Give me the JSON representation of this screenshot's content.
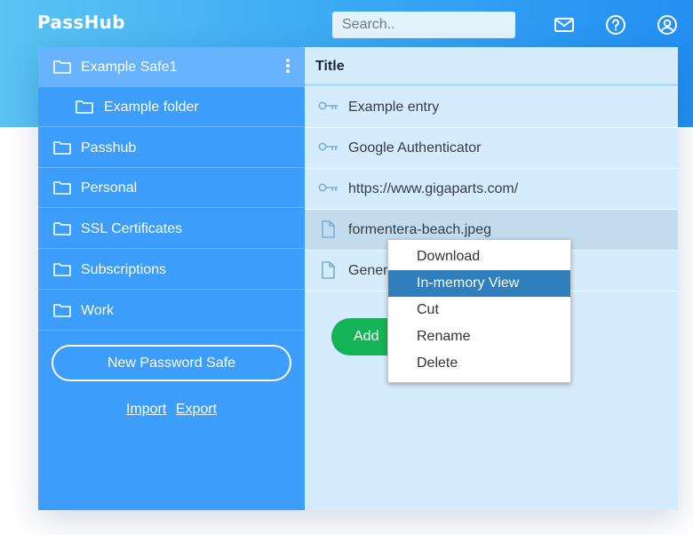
{
  "app": {
    "logo": "PassHub"
  },
  "search": {
    "placeholder": "Search.."
  },
  "header_icons": [
    "mail-icon",
    "help-icon",
    "account-icon"
  ],
  "sidebar": {
    "safes": [
      {
        "label": "Example Safe1",
        "active": true
      },
      {
        "label": "Example folder",
        "sub": true
      },
      {
        "label": "Passhub"
      },
      {
        "label": "Personal"
      },
      {
        "label": "SSL Certificates"
      },
      {
        "label": "Subscriptions"
      },
      {
        "label": "Work"
      }
    ],
    "new_safe_label": "New Password Safe",
    "import_label": "Import",
    "export_label": "Export"
  },
  "main": {
    "column_title": "Title",
    "items": [
      {
        "label": "Example entry",
        "icon": "key-icon"
      },
      {
        "label": "Google Authenticator",
        "icon": "key-icon"
      },
      {
        "label": "https://www.gigaparts.com/",
        "icon": "key-icon"
      },
      {
        "label": "formentera-beach.jpeg",
        "icon": "file-icon",
        "selected": true
      },
      {
        "label": "Generl",
        "icon": "file-icon"
      }
    ],
    "add_label": "Add"
  },
  "context_menu": {
    "items": [
      "Download",
      "In-memory View",
      "Cut",
      "Rename",
      "Delete"
    ],
    "highlighted": "In-memory View"
  },
  "colors": {
    "header_gradient": [
      "#5bc3f3",
      "#238ff2"
    ],
    "sidebar": "#3c9dfa",
    "sidebar_active": "#68b3fb",
    "content": "#d5ecfd",
    "add_button": "#15b357",
    "menu_highlight": "#2f7fbc"
  }
}
